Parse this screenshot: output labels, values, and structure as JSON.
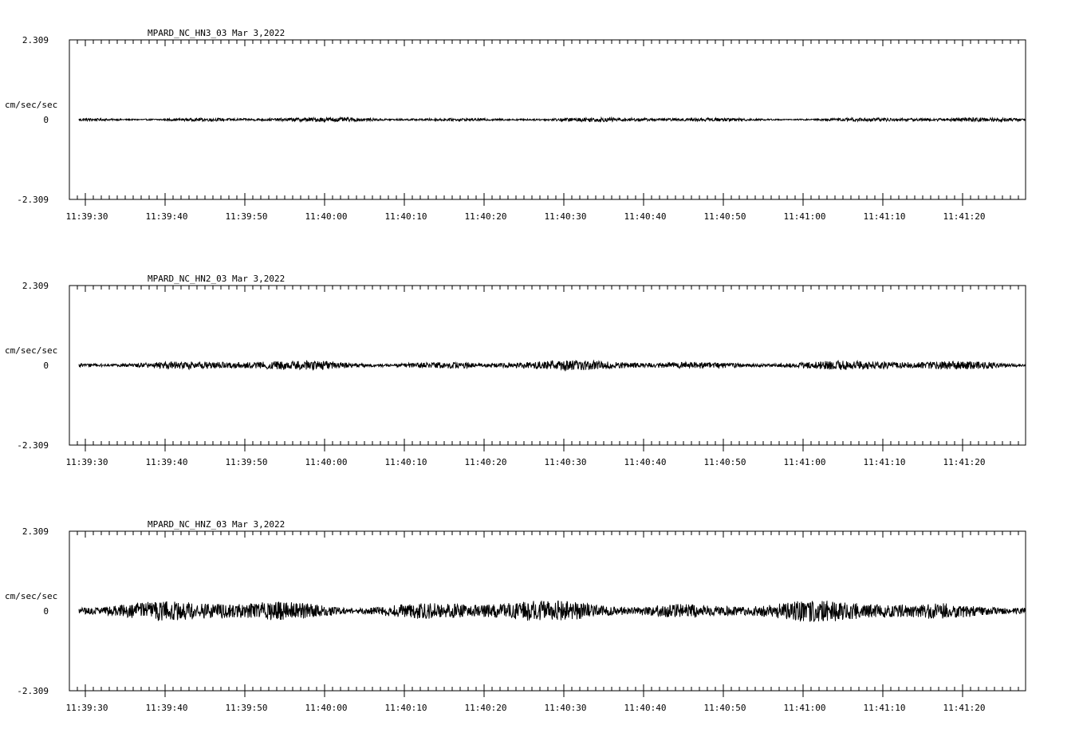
{
  "chart_data": [
    {
      "type": "line",
      "title": "MPARD_NC_HN3_03  Mar 3,2022",
      "ylabel": "cm/sec/sec",
      "ylim": [
        -2.309,
        2.309
      ],
      "yticks": [
        "2.309",
        "0",
        "-2.309"
      ],
      "xticks": [
        "11:39:30",
        "11:39:40",
        "11:39:50",
        "11:40:00",
        "11:40:10",
        "11:40:20",
        "11:40:30",
        "11:40:40",
        "11:40:50",
        "11:41:00",
        "11:41:10",
        "11:41:20"
      ],
      "series": [
        {
          "noise_amplitude": 0.04,
          "values": []
        }
      ]
    },
    {
      "type": "line",
      "title": "MPARD_NC_HN2_03  Mar 3,2022",
      "ylabel": "cm/sec/sec",
      "ylim": [
        -2.309,
        2.309
      ],
      "yticks": [
        "2.309",
        "0",
        "-2.309"
      ],
      "xticks": [
        "11:39:30",
        "11:39:40",
        "11:39:50",
        "11:40:00",
        "11:40:10",
        "11:40:20",
        "11:40:30",
        "11:40:40",
        "11:40:50",
        "11:41:00",
        "11:41:10",
        "11:41:20"
      ],
      "series": [
        {
          "noise_amplitude": 0.09,
          "values": []
        }
      ]
    },
    {
      "type": "line",
      "title": "MPARD_NC_HNZ_03  Mar 3,2022",
      "ylabel": "cm/sec/sec",
      "ylim": [
        -2.309,
        2.309
      ],
      "yticks": [
        "2.309",
        "0",
        "-2.309"
      ],
      "xticks": [
        "11:39:30",
        "11:39:40",
        "11:39:50",
        "11:40:00",
        "11:40:10",
        "11:40:20",
        "11:40:30",
        "11:40:40",
        "11:40:50",
        "11:41:00",
        "11:41:10",
        "11:41:20"
      ],
      "series": [
        {
          "noise_amplitude": 0.2,
          "values": []
        }
      ]
    }
  ]
}
